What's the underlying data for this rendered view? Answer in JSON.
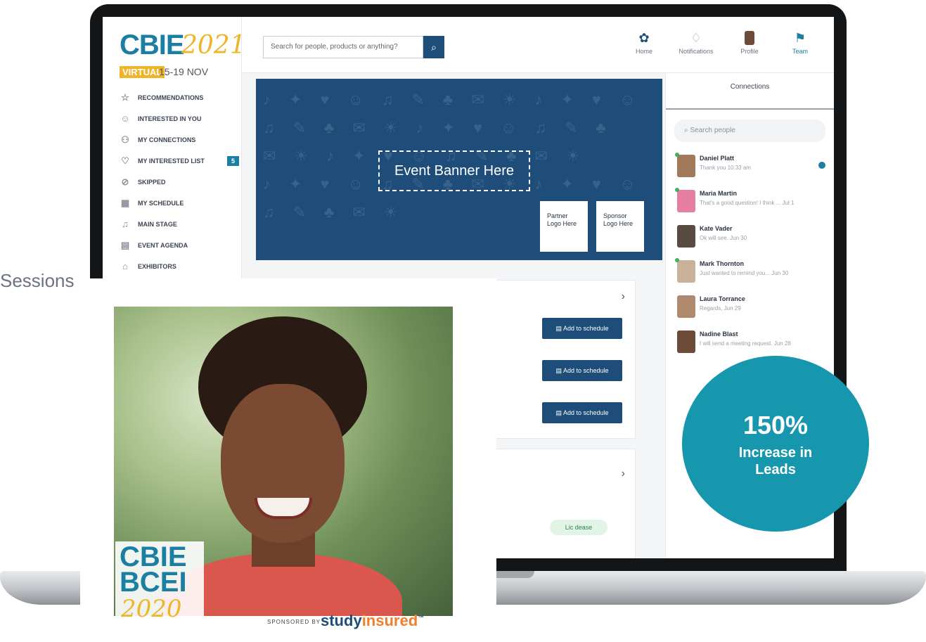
{
  "sidebar": {
    "logo_title": "CBIE",
    "logo_year": "2021",
    "logo_virtual": "VIRTUAL",
    "logo_dates": "15-19 NOV",
    "items": [
      {
        "label": "RECOMMENDATIONS",
        "icon": "star-icon"
      },
      {
        "label": "INTERESTED IN YOU",
        "icon": "smile-icon"
      },
      {
        "label": "MY CONNECTIONS",
        "icon": "people-icon"
      },
      {
        "label": "MY INTERESTED LIST",
        "icon": "thumbs-up-icon",
        "badge": "5"
      },
      {
        "label": "SKIPPED",
        "icon": "skip-icon"
      },
      {
        "label": "MY SCHEDULE",
        "icon": "calendar-icon"
      },
      {
        "label": "MAIN STAGE",
        "icon": "stage-icon"
      },
      {
        "label": "EVENT AGENDA",
        "icon": "agenda-icon"
      },
      {
        "label": "EXHIBITORS",
        "icon": "exhibitors-icon"
      }
    ]
  },
  "topbar": {
    "search_placeholder": "Search for people, products or anything?",
    "nav": [
      {
        "label": "Home",
        "icon": "home-icon"
      },
      {
        "label": "Notifications",
        "icon": "bell-icon"
      },
      {
        "label": "Profile",
        "icon": "avatar"
      },
      {
        "label": "Team",
        "icon": "team-icon"
      }
    ]
  },
  "banner": {
    "title": "Event Banner Here",
    "partner_logo": "Partner Logo Here",
    "sponsor_logo": "Sponsor Logo Here"
  },
  "sessions": {
    "add_label": "Add to schedule",
    "status_pill": "Lic dease"
  },
  "connections": {
    "title": "Connections",
    "search_placeholder": "Search people",
    "people": [
      {
        "name": "Daniel Platt",
        "message": "Thank you 10:33 am",
        "online": true,
        "unread": true,
        "color": "#a0785a"
      },
      {
        "name": "Maria Martin",
        "message": "That's a good question! I think ... Jul 1",
        "online": true,
        "unread": false,
        "color": "#e77fa4"
      },
      {
        "name": "Kate Vader",
        "message": "Ok will see. Jun 30",
        "online": false,
        "unread": false,
        "color": "#5a4a44"
      },
      {
        "name": "Mark Thornton",
        "message": "Just wanted to remind you... Jun 30",
        "online": true,
        "unread": false,
        "color": "#c9b29a"
      },
      {
        "name": "Laura Torrance",
        "message": "Regards, Jun 29",
        "online": false,
        "unread": false,
        "color": "#b08a6e"
      },
      {
        "name": "Nadine Blast",
        "message": "I will send a meeting request. Jun 28",
        "online": false,
        "unread": false,
        "color": "#6e4a38"
      }
    ]
  },
  "overlay": {
    "session_label": "Sessions",
    "brand_line1": "CBIE",
    "brand_line2": "BCEI",
    "brand_year": "2020",
    "sponsored_by": "SPONSORED BY",
    "sponsor_part1": "study",
    "sponsor_part2": "insured",
    "sponsor_tm": "™"
  },
  "stat": {
    "value": "150%",
    "line1": "Increase in",
    "line2": "Leads"
  },
  "colors": {
    "brand_teal": "#1b7fa3",
    "brand_gold": "#f0b429",
    "navy": "#1e4d7a",
    "stat_circle": "#1797ae"
  }
}
